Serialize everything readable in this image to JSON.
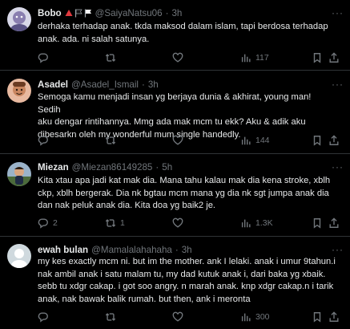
{
  "tweets": [
    {
      "name": "Bobo",
      "emojis": "▲⚑⚐",
      "handle": "@SaiyaNatsu06",
      "dot": "·",
      "time": "3h",
      "text": "derhaka terhadap anak. tkda maksod dalam islam, tapi berdosa terhadap\nanak. ada. ni salah satunya.",
      "replies": "",
      "retweets": "",
      "likes": "",
      "views": "117"
    },
    {
      "name": "Asadel",
      "emojis": "",
      "handle": "@Asadel_Ismail",
      "dot": "·",
      "time": "3h",
      "text": "Semoga kamu menjadi insan yg berjaya dunia & akhirat, young man! Sedih\naku dengar rintihannya. Mmg ada mak mcm tu ekk? Aku & adik aku\ndibesarkn oleh my wonderful mum single handedly.",
      "replies": "",
      "retweets": "",
      "likes": "",
      "views": "144"
    },
    {
      "name": "Miezan",
      "emojis": "",
      "handle": "@Miezan86149285",
      "dot": "·",
      "time": "5h",
      "text": "Kita xtau apa jadi kat mak dia. Mana tahu kalau mak dia kena stroke, xblh\nckp, xblh bergerak. Dia nk bgtau mcm mana yg dia nk sgt jumpa anak dia\ndan nak peluk anak dia. Kita doa yg baik2 je.",
      "replies": "2",
      "retweets": "1",
      "likes": "",
      "views": "1.3K"
    },
    {
      "name": "ewah bulan",
      "emojis": "",
      "handle": "@Mamalalahahaha",
      "dot": "·",
      "time": "3h",
      "text": "my kes exactly mcm ni. but im the mother. ank I lelaki. anak i umur 9tahun.i\nnak ambil anak i satu malam tu, my dad kutuk anak i, dari baka yg xbaik.\nsebb tu xdgr cakap. i got soo angry.  n marah anak. knp xdgr cakap.n i tarik\nanak, nak bawak balik rumah. but then, ank i meronta",
      "replies": "",
      "retweets": "",
      "likes": "",
      "views": "300"
    }
  ],
  "more_glyph": "···",
  "colors": {
    "background": "#000000",
    "text": "#e7e9ea",
    "muted": "#71767b",
    "divider": "#2f3336"
  }
}
